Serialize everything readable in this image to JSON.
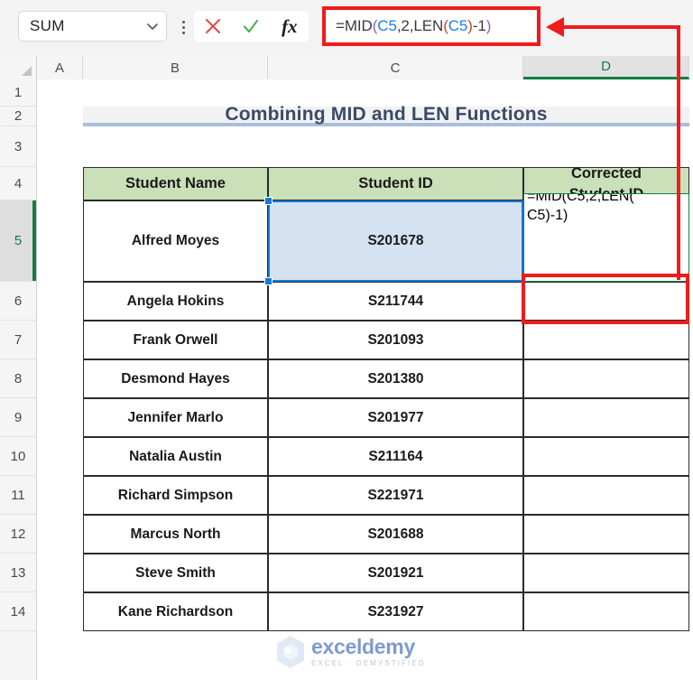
{
  "formula_bar": {
    "name_box_value": "SUM",
    "name_box_icon": "chevron-down-icon",
    "options_icon": "kebab-menu-icon",
    "cancel_icon": "cancel-x-icon",
    "enter_icon": "confirm-check-icon",
    "insert_function_icon": "fx-icon",
    "insert_function_label": "fx",
    "formula_text": "=MID(C5,2,LEN(C5)-1)",
    "formula_tokens": [
      {
        "t": "=MID",
        "c": "plain"
      },
      {
        "t": "(",
        "c": "p1"
      },
      {
        "t": "C5",
        "c": "ref"
      },
      {
        "t": ",2,LEN",
        "c": "plain"
      },
      {
        "t": "(",
        "c": "p2"
      },
      {
        "t": "C5",
        "c": "ref"
      },
      {
        "t": ")",
        "c": "p2"
      },
      {
        "t": "-1",
        "c": "plain"
      },
      {
        "t": ")",
        "c": "p1"
      }
    ]
  },
  "grid": {
    "columns": [
      "A",
      "B",
      "C",
      "D"
    ],
    "selected_column": "D",
    "rows": [
      "1",
      "2",
      "3",
      "4",
      "5",
      "6",
      "7",
      "8",
      "9",
      "10",
      "11",
      "12",
      "13",
      "14"
    ],
    "selected_row": "5"
  },
  "title_banner": {
    "text": "Combining MID and LEN Functions"
  },
  "table": {
    "headers": [
      "Student Name",
      "Student ID",
      "Corrected Student ID"
    ],
    "header_lines": [
      [
        "Student Name"
      ],
      [
        "Student ID"
      ],
      [
        "Corrected",
        "Student ID"
      ]
    ],
    "rows": [
      {
        "row": "5",
        "name": "Alfred Moyes",
        "id": "S201678",
        "corrected": ""
      },
      {
        "row": "6",
        "name": "Angela Hokins",
        "id": "S211744",
        "corrected": ""
      },
      {
        "row": "7",
        "name": "Frank Orwell",
        "id": "S201093",
        "corrected": ""
      },
      {
        "row": "8",
        "name": "Desmond Hayes",
        "id": "S201380",
        "corrected": ""
      },
      {
        "row": "9",
        "name": "Jennifer Marlo",
        "id": "S201977",
        "corrected": ""
      },
      {
        "row": "10",
        "name": "Natalia Austin",
        "id": "S211164",
        "corrected": ""
      },
      {
        "row": "11",
        "name": "Richard Simpson",
        "id": "S221971",
        "corrected": ""
      },
      {
        "row": "12",
        "name": "Marcus North",
        "id": "S201688",
        "corrected": ""
      },
      {
        "row": "13",
        "name": "Steve Smith",
        "id": "S201921",
        "corrected": ""
      },
      {
        "row": "14",
        "name": "Kane Richardson",
        "id": "S231927",
        "corrected": ""
      }
    ]
  },
  "active_cell": {
    "reference_cell": "C5",
    "reference_value": "S201678",
    "editing_cell": "D5",
    "incell_line1": "=MID(C5,2,LEN(",
    "incell_line2": "C5)-1)"
  },
  "annotation": {
    "arrow_icon": "red-arrow-left-icon",
    "highlight_color": "#ee1c1c"
  },
  "watermark": {
    "name": "exceldemy",
    "subtitle": "EXCEL · DEMYSTIFIED",
    "logo_icon": "exceldemy-hex-logo-icon"
  },
  "colors": {
    "header_green": "#c9e0b8",
    "selection_blue": "#1a78d2",
    "selection_fill": "#d4e2f2",
    "excel_green": "#127d42",
    "title_border": "#a9bddf",
    "annotation_red": "#ee1c1c"
  }
}
